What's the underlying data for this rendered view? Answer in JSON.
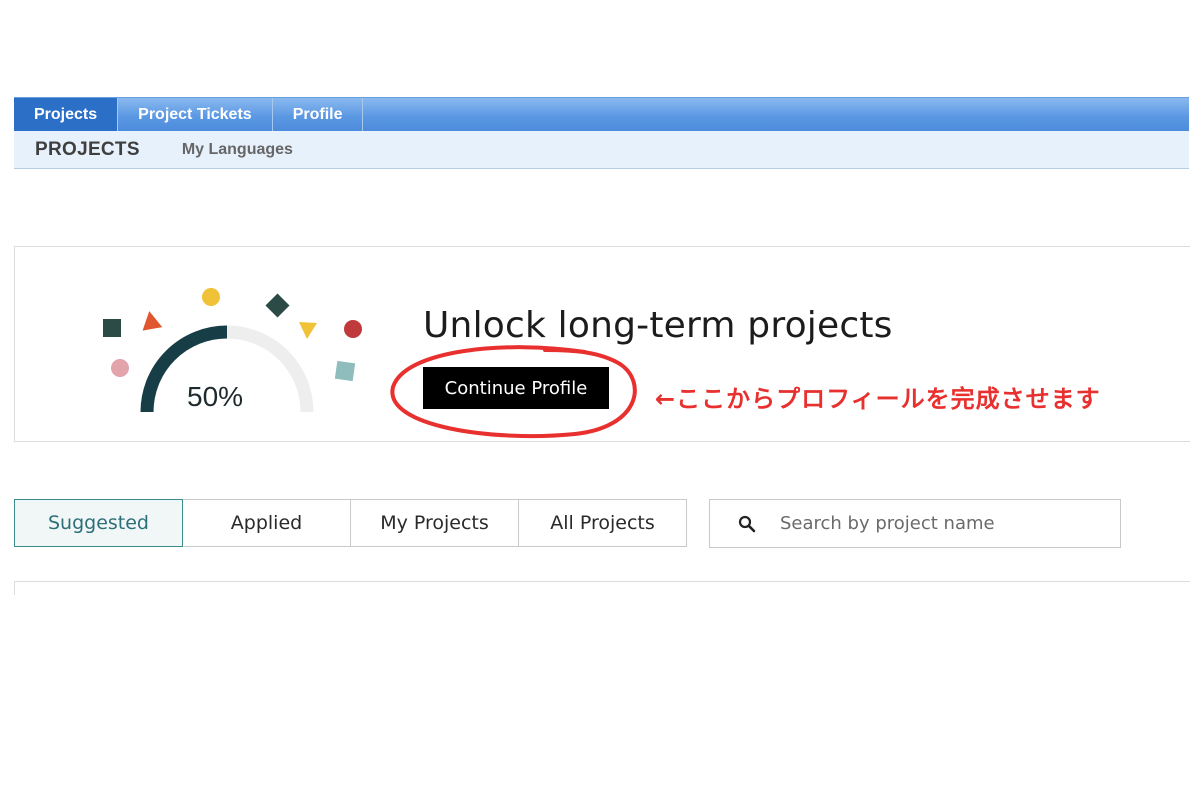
{
  "topnav": {
    "tabs": [
      {
        "label": "Projects",
        "active": true
      },
      {
        "label": "Project Tickets",
        "active": false
      },
      {
        "label": "Profile",
        "active": false
      }
    ]
  },
  "subnav": {
    "title": "PROJECTS",
    "link": "My Languages"
  },
  "banner": {
    "progress_percent": 50,
    "progress_label": "50%",
    "headline": "Unlock long-term projects",
    "cta_label": "Continue Profile",
    "annotation": "←ここからプロフィールを完成させます"
  },
  "filters": {
    "tabs": [
      {
        "label": "Suggested",
        "active": true
      },
      {
        "label": "Applied",
        "active": false
      },
      {
        "label": "My Projects",
        "active": false
      },
      {
        "label": "All Projects",
        "active": false
      }
    ]
  },
  "search": {
    "placeholder": "Search by project name",
    "icon": "search-icon"
  },
  "colors": {
    "nav_active": "#2c6fc7",
    "gauge_fill": "#173e46",
    "gauge_track": "#eeeeee",
    "annotation": "#e8302e",
    "active_tab_text": "#2d6f77"
  }
}
